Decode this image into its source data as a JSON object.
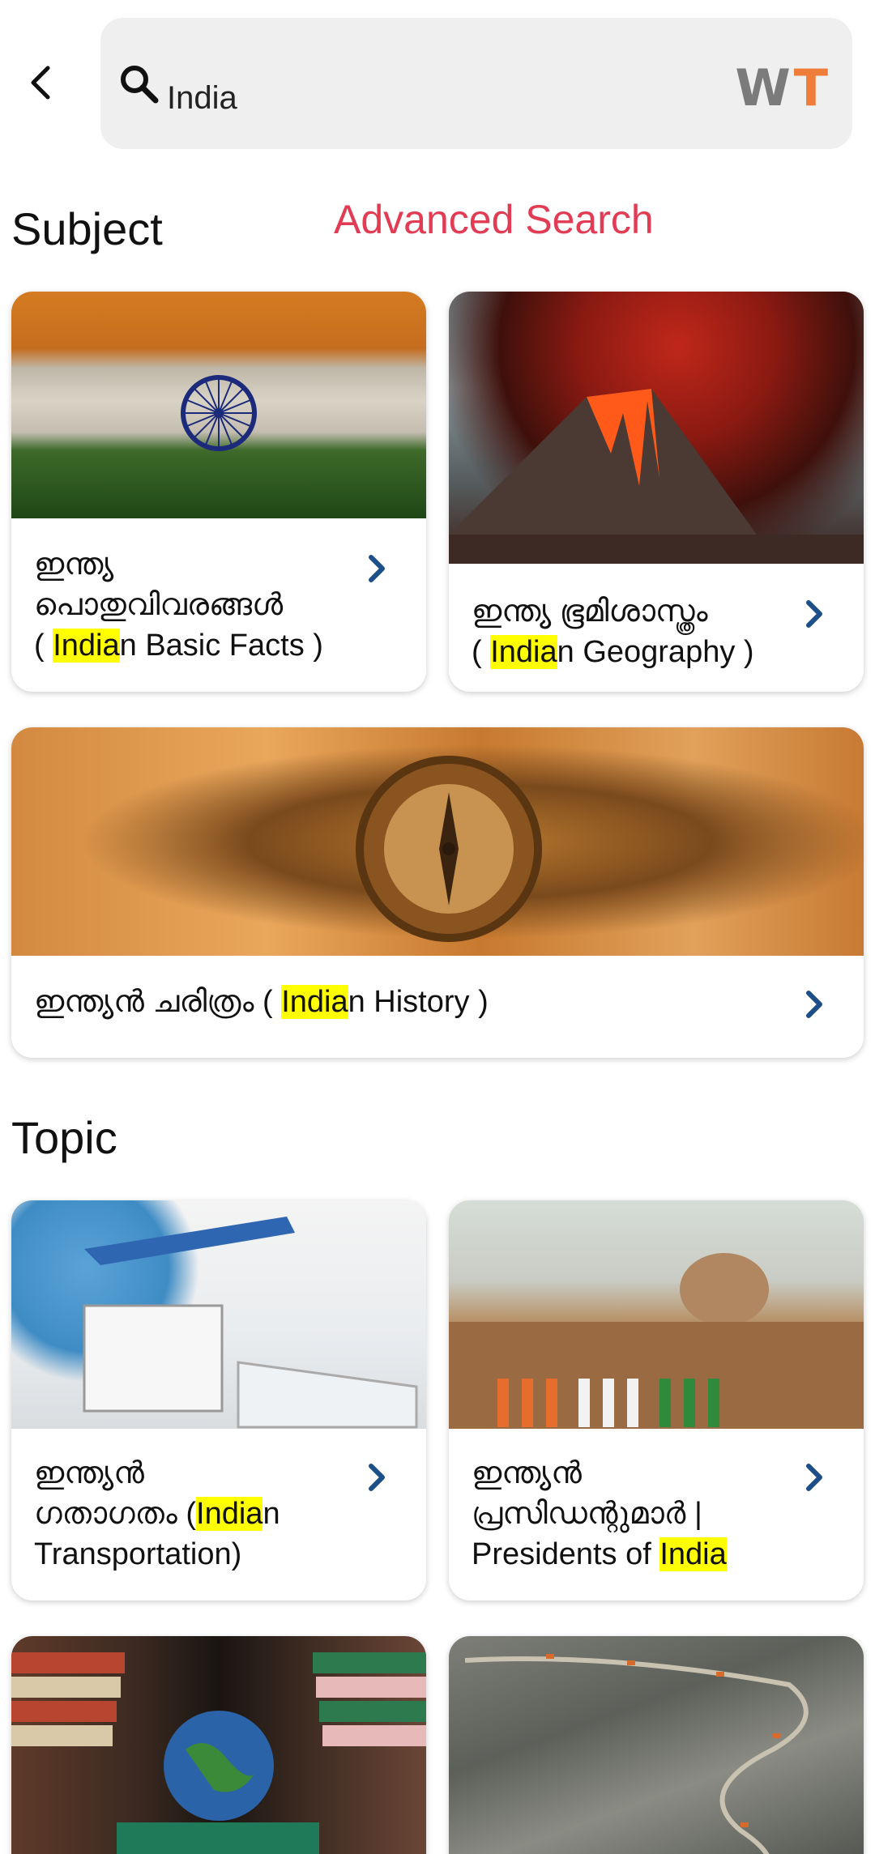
{
  "search": {
    "query": "India"
  },
  "logo": {
    "w": "W",
    "t": "T"
  },
  "sections": {
    "subject_title": "Subject",
    "advanced_search": "Advanced Search",
    "topic_title": "Topic"
  },
  "subject_cards": [
    {
      "line1": "ഇന്ത്യ",
      "line2": "പൊതുവിവരങ്ങൾ",
      "pre": "( ",
      "hl": "India",
      "post": "n Basic Facts )"
    },
    {
      "line1": "ഇന്ത്യ ഭൂമിശാസ്ത്രം",
      "pre": "( ",
      "hl": "India",
      "post": "n Geography )"
    },
    {
      "prefix": "ഇന്ത്യൻ ചരിത്രം  ( ",
      "hl": "India",
      "post": "n History )"
    }
  ],
  "topic_cards": [
    {
      "line1": "ഇന്ത്യൻ",
      "pre": "ഗതാഗതം (",
      "hl": "India",
      "post": "n",
      "line3": "Transportation)"
    },
    {
      "line1": "ഇന്ത്യൻ",
      "line2": "പ്രസിഡന്റുമാർ |",
      "pre": "Presidents of ",
      "hl": "India"
    }
  ],
  "icons": {
    "back": "arrow-back-icon",
    "search": "search-icon",
    "chevron": "chevron-right-icon"
  },
  "colors": {
    "accent_red": "#e23c55",
    "chevron_blue": "#1c4f8a",
    "highlight": "#ffff00",
    "logo_orange": "#ef7d3a",
    "logo_gray": "#7b7b7b"
  }
}
